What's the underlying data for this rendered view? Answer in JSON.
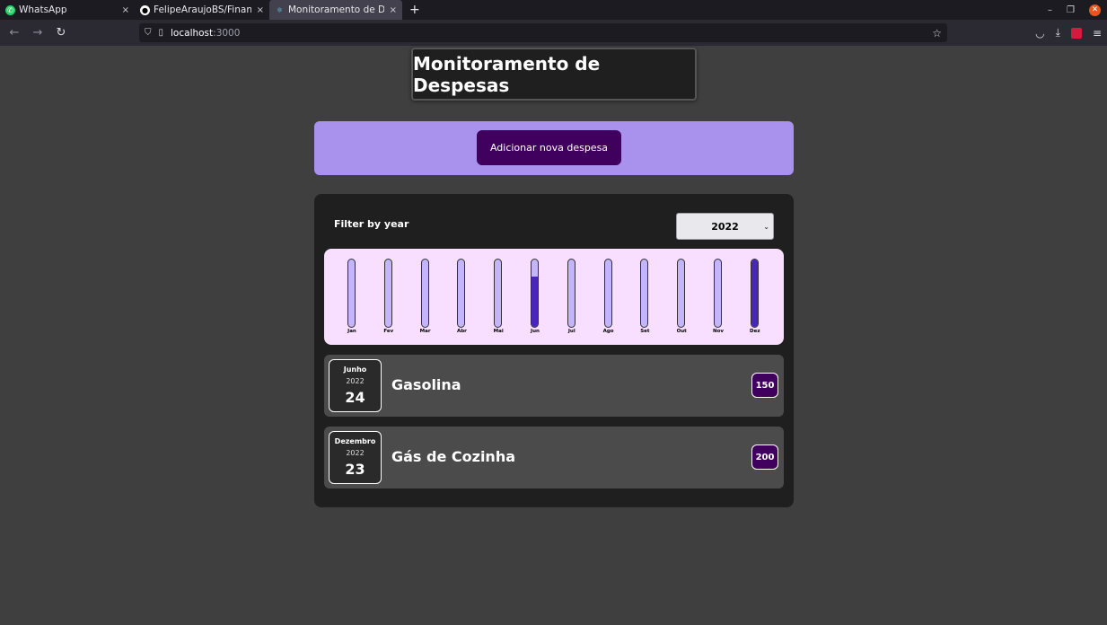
{
  "browser": {
    "tabs": [
      {
        "title": "WhatsApp",
        "close": "×"
      },
      {
        "title": "FelipeAraujoBS/Finances",
        "close": "×"
      },
      {
        "title": "Monitoramento de Despesas",
        "close": "×"
      }
    ],
    "new_tab": "+",
    "url_host": "localhost",
    "url_port": ":3000"
  },
  "page": {
    "title": "Monitoramento de Despesas",
    "add_button": "Adicionar nova despesa",
    "filter_label": "Filter by year",
    "selected_year": "2022"
  },
  "chart_data": {
    "type": "bar",
    "categories": [
      "Jan",
      "Fev",
      "Mar",
      "Abr",
      "Mai",
      "Jun",
      "Jul",
      "Ago",
      "Set",
      "Out",
      "Nov",
      "Dez"
    ],
    "values": [
      0,
      0,
      0,
      0,
      0,
      150,
      0,
      0,
      0,
      0,
      0,
      200
    ],
    "ylim": [
      0,
      200
    ],
    "colors": {
      "track": "#c3b4fc",
      "fill": "#4826b9"
    }
  },
  "expenses": [
    {
      "month": "Junho",
      "year": "2022",
      "day": "24",
      "title": "Gasolina",
      "amount": "150"
    },
    {
      "month": "Dezembro",
      "year": "2022",
      "day": "23",
      "title": "Gás de Cozinha",
      "amount": "200"
    }
  ],
  "colors": {
    "accent_panel": "#a892ee",
    "button": "#40005d",
    "background": "#3f3f3f"
  }
}
